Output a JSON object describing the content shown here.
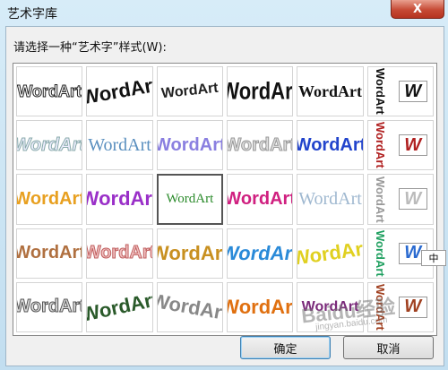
{
  "window": {
    "title": "艺术字库",
    "close_glyph": "X"
  },
  "prompt": "请选择一种“艺术字”样式(W):",
  "wordart_text": "WordArt",
  "wordart_icon_letter": "W",
  "buttons": {
    "ok": "确定",
    "cancel": "取消"
  },
  "ime_indicator": {
    "mode": "中"
  },
  "watermark": {
    "logo": "Baidu经验",
    "url": "jingyan.baidu.com"
  },
  "gallery": {
    "rows": 5,
    "columns": 6,
    "selected": {
      "row": 3,
      "column": 2
    }
  },
  "colors": {
    "title_bar": "#c2def0",
    "close_button": "#c64a35",
    "client_bg": "#f0f0f0",
    "selection_border": "#555555"
  }
}
